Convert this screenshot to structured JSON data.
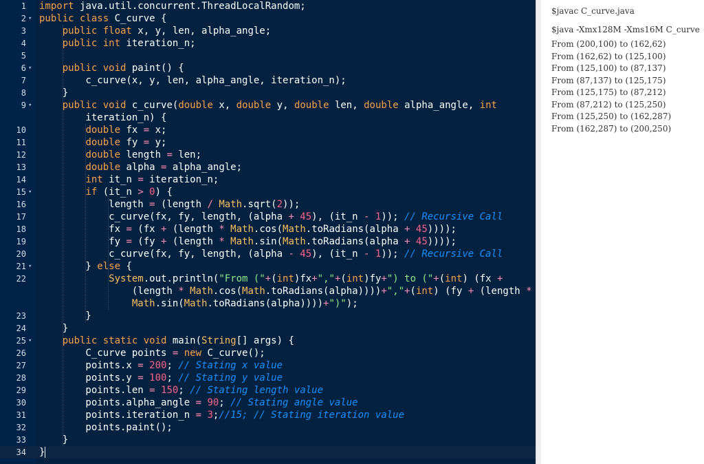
{
  "editor": {
    "lines": [
      {
        "num": "1",
        "fold": "",
        "code": [
          [
            "kw",
            "import "
          ],
          [
            "t",
            "java.util.concurrent.ThreadLocalRandom;"
          ]
        ]
      },
      {
        "num": "2",
        "fold": "▾",
        "code": [
          [
            "kw",
            "public class "
          ],
          [
            "t",
            "C_curve {"
          ]
        ]
      },
      {
        "num": "3",
        "fold": "",
        "code": [
          [
            "t",
            "    "
          ],
          [
            "kw",
            "public float "
          ],
          [
            "t",
            "x, y, len, alpha_angle;"
          ]
        ]
      },
      {
        "num": "4",
        "fold": "",
        "code": [
          [
            "t",
            "    "
          ],
          [
            "kw",
            "public int "
          ],
          [
            "t",
            "iteration_n;"
          ]
        ]
      },
      {
        "num": "5",
        "fold": "",
        "code": []
      },
      {
        "num": "6",
        "fold": "▾",
        "code": [
          [
            "t",
            "    "
          ],
          [
            "kw",
            "public void "
          ],
          [
            "t",
            "paint() {"
          ]
        ]
      },
      {
        "num": "7",
        "fold": "",
        "code": [
          [
            "t",
            "        c_curve(x, y, len, alpha_angle, iteration_n);"
          ]
        ]
      },
      {
        "num": "8",
        "fold": "",
        "code": [
          [
            "t",
            "    }"
          ]
        ]
      },
      {
        "num": "9",
        "fold": "▾",
        "code": [
          [
            "t",
            "    "
          ],
          [
            "kw",
            "public void "
          ],
          [
            "t",
            "c_curve("
          ],
          [
            "kw",
            "double "
          ],
          [
            "t",
            "x, "
          ],
          [
            "kw",
            "double "
          ],
          [
            "t",
            "y, "
          ],
          [
            "kw",
            "double "
          ],
          [
            "t",
            "len, "
          ],
          [
            "kw",
            "double "
          ],
          [
            "t",
            "alpha_angle, "
          ],
          [
            "kw",
            "int"
          ]
        ]
      },
      {
        "num": "",
        "fold": "",
        "code": [
          [
            "t",
            "        iteration_n) {"
          ]
        ]
      },
      {
        "num": "10",
        "fold": "",
        "code": [
          [
            "t",
            "        "
          ],
          [
            "kw",
            "double "
          ],
          [
            "t",
            "fx "
          ],
          [
            "op",
            "= "
          ],
          [
            "t",
            "x;"
          ]
        ]
      },
      {
        "num": "11",
        "fold": "",
        "code": [
          [
            "t",
            "        "
          ],
          [
            "kw",
            "double "
          ],
          [
            "t",
            "fy "
          ],
          [
            "op",
            "= "
          ],
          [
            "t",
            "y;"
          ]
        ]
      },
      {
        "num": "12",
        "fold": "",
        "code": [
          [
            "t",
            "        "
          ],
          [
            "kw",
            "double "
          ],
          [
            "t",
            "length "
          ],
          [
            "op",
            "= "
          ],
          [
            "t",
            "len;"
          ]
        ]
      },
      {
        "num": "13",
        "fold": "",
        "code": [
          [
            "t",
            "        "
          ],
          [
            "kw",
            "double "
          ],
          [
            "t",
            "alpha "
          ],
          [
            "op",
            "= "
          ],
          [
            "t",
            "alpha_angle;"
          ]
        ]
      },
      {
        "num": "14",
        "fold": "",
        "code": [
          [
            "t",
            "        "
          ],
          [
            "kw",
            "int "
          ],
          [
            "t",
            "it_n "
          ],
          [
            "op",
            "= "
          ],
          [
            "t",
            "iteration_n;"
          ]
        ]
      },
      {
        "num": "15",
        "fold": "▾",
        "code": [
          [
            "t",
            "        "
          ],
          [
            "kw",
            "if "
          ],
          [
            "t",
            "(it_n "
          ],
          [
            "op",
            "> "
          ],
          [
            "num",
            "0"
          ],
          [
            "t",
            ") {"
          ]
        ]
      },
      {
        "num": "16",
        "fold": "",
        "code": [
          [
            "t",
            "            length "
          ],
          [
            "op",
            "= "
          ],
          [
            "t",
            "(length "
          ],
          [
            "op",
            "/ "
          ],
          [
            "cls",
            "Math"
          ],
          [
            "t",
            ".sqrt("
          ],
          [
            "num",
            "2"
          ],
          [
            "t",
            "));"
          ]
        ]
      },
      {
        "num": "17",
        "fold": "",
        "code": [
          [
            "t",
            "            c_curve(fx, fy, length, (alpha "
          ],
          [
            "op",
            "+ "
          ],
          [
            "num",
            "45"
          ],
          [
            "t",
            "), (it_n "
          ],
          [
            "op",
            "- "
          ],
          [
            "num",
            "1"
          ],
          [
            "t",
            "));"
          ],
          [
            "com",
            " // Recursive Call"
          ]
        ]
      },
      {
        "num": "18",
        "fold": "",
        "code": [
          [
            "t",
            "            fx "
          ],
          [
            "op",
            "= "
          ],
          [
            "t",
            "(fx "
          ],
          [
            "op",
            "+ "
          ],
          [
            "t",
            "(length "
          ],
          [
            "op",
            "* "
          ],
          [
            "cls",
            "Math"
          ],
          [
            "t",
            ".cos("
          ],
          [
            "cls",
            "Math"
          ],
          [
            "t",
            ".toRadians(alpha "
          ],
          [
            "op",
            "+ "
          ],
          [
            "num",
            "45"
          ],
          [
            "t",
            "))));"
          ]
        ]
      },
      {
        "num": "19",
        "fold": "",
        "code": [
          [
            "t",
            "            fy "
          ],
          [
            "op",
            "= "
          ],
          [
            "t",
            "(fy "
          ],
          [
            "op",
            "+ "
          ],
          [
            "t",
            "(length "
          ],
          [
            "op",
            "* "
          ],
          [
            "cls",
            "Math"
          ],
          [
            "t",
            ".sin("
          ],
          [
            "cls",
            "Math"
          ],
          [
            "t",
            ".toRadians(alpha "
          ],
          [
            "op",
            "+ "
          ],
          [
            "num",
            "45"
          ],
          [
            "t",
            "))));"
          ]
        ]
      },
      {
        "num": "20",
        "fold": "",
        "code": [
          [
            "t",
            "            c_curve(fx, fy, length, (alpha "
          ],
          [
            "op",
            "- "
          ],
          [
            "num",
            "45"
          ],
          [
            "t",
            "), (it_n "
          ],
          [
            "op",
            "- "
          ],
          [
            "num",
            "1"
          ],
          [
            "t",
            "));"
          ],
          [
            "com",
            " // Recursive Call"
          ]
        ]
      },
      {
        "num": "21",
        "fold": "▾",
        "code": [
          [
            "t",
            "        } "
          ],
          [
            "kw",
            "else "
          ],
          [
            "t",
            "{"
          ]
        ]
      },
      {
        "num": "22",
        "fold": "",
        "code": [
          [
            "t",
            "            "
          ],
          [
            "cls",
            "System"
          ],
          [
            "t",
            ".out.println("
          ],
          [
            "str",
            "\"From (\""
          ],
          [
            "op",
            "+"
          ],
          [
            "t",
            "("
          ],
          [
            "kw",
            "int"
          ],
          [
            "t",
            ")fx"
          ],
          [
            "op",
            "+"
          ],
          [
            "str",
            "\",\""
          ],
          [
            "op",
            "+"
          ],
          [
            "t",
            "("
          ],
          [
            "kw",
            "int"
          ],
          [
            "t",
            ")fy"
          ],
          [
            "op",
            "+"
          ],
          [
            "str",
            "\") to (\""
          ],
          [
            "op",
            "+"
          ],
          [
            "t",
            "("
          ],
          [
            "kw",
            "int"
          ],
          [
            "t",
            ") (fx "
          ],
          [
            "op",
            "+"
          ]
        ]
      },
      {
        "num": "",
        "fold": "",
        "code": [
          [
            "t",
            "                (length "
          ],
          [
            "op",
            "* "
          ],
          [
            "cls",
            "Math"
          ],
          [
            "t",
            ".cos("
          ],
          [
            "cls",
            "Math"
          ],
          [
            "t",
            ".toRadians(alpha))))"
          ],
          [
            "op",
            "+"
          ],
          [
            "str",
            "\",\""
          ],
          [
            "op",
            "+"
          ],
          [
            "t",
            "("
          ],
          [
            "kw",
            "int"
          ],
          [
            "t",
            ") (fy "
          ],
          [
            "op",
            "+ "
          ],
          [
            "t",
            "(length "
          ],
          [
            "op",
            "*"
          ]
        ]
      },
      {
        "num": "",
        "fold": "",
        "code": [
          [
            "t",
            "                "
          ],
          [
            "cls",
            "Math"
          ],
          [
            "t",
            ".sin("
          ],
          [
            "cls",
            "Math"
          ],
          [
            "t",
            ".toRadians(alpha))))"
          ],
          [
            "op",
            "+"
          ],
          [
            "str",
            "\")\""
          ],
          [
            "t",
            ");"
          ]
        ]
      },
      {
        "num": "23",
        "fold": "",
        "code": [
          [
            "t",
            "        }"
          ]
        ]
      },
      {
        "num": "24",
        "fold": "",
        "code": [
          [
            "t",
            "    }"
          ]
        ]
      },
      {
        "num": "25",
        "fold": "▾",
        "code": [
          [
            "t",
            "    "
          ],
          [
            "kw",
            "public static void "
          ],
          [
            "t",
            "main("
          ],
          [
            "cls",
            "String"
          ],
          [
            "t",
            "[] args) {"
          ]
        ]
      },
      {
        "num": "26",
        "fold": "",
        "code": [
          [
            "t",
            "        C_curve points "
          ],
          [
            "op",
            "= "
          ],
          [
            "kw",
            "new "
          ],
          [
            "t",
            "C_curve();"
          ]
        ]
      },
      {
        "num": "27",
        "fold": "",
        "code": [
          [
            "t",
            "        points.x "
          ],
          [
            "op",
            "= "
          ],
          [
            "num",
            "200"
          ],
          [
            "t",
            "; "
          ],
          [
            "com",
            "// Stating x value"
          ]
        ]
      },
      {
        "num": "28",
        "fold": "",
        "code": [
          [
            "t",
            "        points.y "
          ],
          [
            "op",
            "= "
          ],
          [
            "num",
            "100"
          ],
          [
            "t",
            "; "
          ],
          [
            "com",
            "// Stating y value"
          ]
        ]
      },
      {
        "num": "29",
        "fold": "",
        "code": [
          [
            "t",
            "        points.len "
          ],
          [
            "op",
            "= "
          ],
          [
            "num",
            "150"
          ],
          [
            "t",
            "; "
          ],
          [
            "com",
            "// Stating length value"
          ]
        ]
      },
      {
        "num": "30",
        "fold": "",
        "code": [
          [
            "t",
            "        points.alpha_angle "
          ],
          [
            "op",
            "= "
          ],
          [
            "num",
            "90"
          ],
          [
            "t",
            "; "
          ],
          [
            "com",
            "// Stating angle value"
          ]
        ]
      },
      {
        "num": "31",
        "fold": "",
        "code": [
          [
            "t",
            "        points.iteration_n "
          ],
          [
            "op",
            "= "
          ],
          [
            "num",
            "3"
          ],
          [
            "t",
            ";"
          ],
          [
            "com",
            "//15; // Stating iteration value"
          ]
        ]
      },
      {
        "num": "32",
        "fold": "",
        "code": [
          [
            "t",
            "        points.paint();"
          ]
        ]
      },
      {
        "num": "33",
        "fold": "",
        "code": [
          [
            "t",
            "    }"
          ]
        ]
      },
      {
        "num": "34",
        "fold": "",
        "code": [
          [
            "t",
            "}"
          ]
        ],
        "active": true
      }
    ]
  },
  "output": {
    "compile_cmd": "$javac C_curve.java",
    "run_cmd": "$java -Xmx128M -Xms16M C_curve",
    "lines": [
      "From (200,100) to (162,62)",
      "From (162,62) to (125,100)",
      "From (125,100) to (87,137)",
      "From (87,137) to (125,175)",
      "From (125,175) to (87,212)",
      "From (87,212) to (125,250)",
      "From (125,250) to (162,287)",
      "From (162,287) to (200,250)"
    ]
  }
}
